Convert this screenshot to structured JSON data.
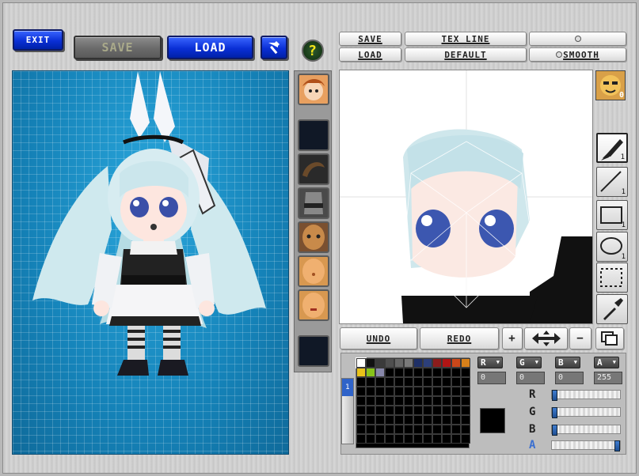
{
  "top_buttons": {
    "exit": "EXIT",
    "save": "SAVE",
    "load": "LOAD"
  },
  "icons": {
    "hammer": "hammer-icon",
    "help": "question-icon"
  },
  "texture_menu": {
    "save": "SAVE",
    "load": "LOAD",
    "tex_line": "TEX LINE",
    "default": "DEFAULT",
    "smooth": "SMOOTH"
  },
  "edit_bar": {
    "undo": "UNDO",
    "redo": "REDO",
    "zoom_in": "+",
    "zoom_out": "−"
  },
  "face_slot_count": "0",
  "tools": [
    {
      "name": "brush-tool",
      "num": "1"
    },
    {
      "name": "line-tool",
      "num": "1"
    },
    {
      "name": "rect-tool",
      "num": "1"
    },
    {
      "name": "ellipse-tool",
      "num": "1"
    },
    {
      "name": "select-tool",
      "num": ""
    },
    {
      "name": "eyedropper-tool",
      "num": ""
    }
  ],
  "channels": {
    "r": {
      "label": "R",
      "value": "0"
    },
    "g": {
      "label": "G",
      "value": "0"
    },
    "b": {
      "label": "B",
      "value": "0"
    },
    "a": {
      "label": "A",
      "value": "255"
    }
  },
  "sliders": [
    {
      "label": "R",
      "level": 0
    },
    {
      "label": "G",
      "level": 0
    },
    {
      "label": "B",
      "level": 0
    },
    {
      "label": "A",
      "level": 1
    }
  ],
  "palette_colors": [
    "#ffffff",
    "#111111",
    "#3a3a3a",
    "#4f4f4f",
    "#666666",
    "#7a7a7a",
    "#1e2f66",
    "#2c3f7a",
    "#8c1c1c",
    "#b01515",
    "#c9471a",
    "#d7801a",
    "#e8c21a",
    "#86c21a",
    "#8888aa"
  ],
  "current_color": "#000000",
  "colors": {
    "accent_blue": "#0a2fd6",
    "viewport_bg": "#1a8fc8"
  }
}
